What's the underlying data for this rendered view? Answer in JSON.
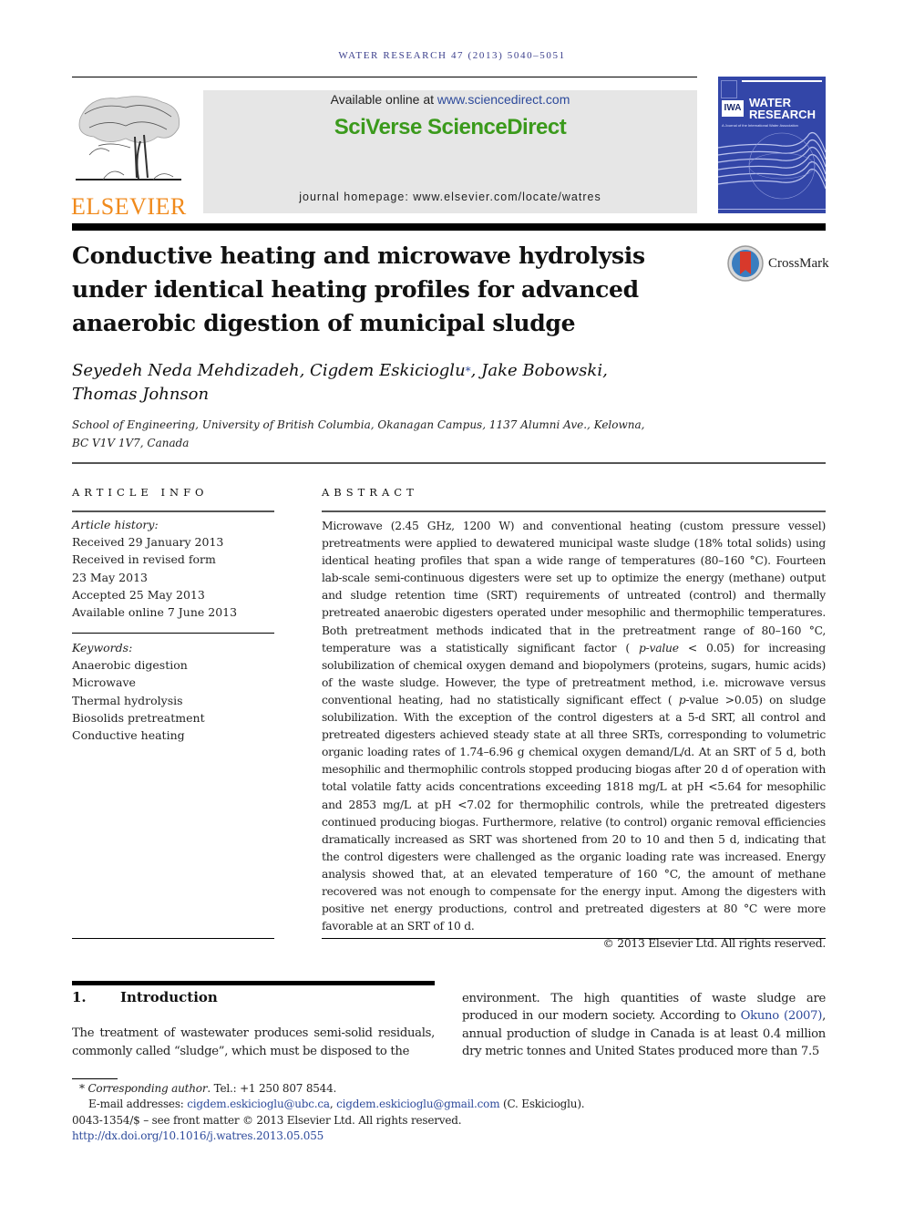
{
  "journal": {
    "running_head": "WATER RESEARCH 47 (2013) 5040–5051",
    "publisher_name": "ELSEVIER",
    "available_online_prefix": "Available online at ",
    "available_online_link": "www.sciencedirect.com",
    "platform_name": "SciVerse ScienceDirect",
    "homepage": "journal homepage: www.elsevier.com/locate/watres",
    "cover": {
      "logo_text": "IWA",
      "title_line1": "WATER",
      "title_line2": "RESEARCH",
      "subtitle": "A Journal of the International Water Association",
      "color": "#3346a8"
    },
    "crossmark_label": "CrossMark"
  },
  "article": {
    "title": "Conductive heating and microwave hydrolysis under identical heating profiles for advanced anaerobic digestion of municipal sludge",
    "authors_part1": "Seyedeh Neda Mehdizadeh, Cigdem Eskicioglu",
    "corresponding_marker": "*",
    "authors_part2": ", Jake Bobowski,",
    "authors_part3": "Thomas Johnson",
    "affiliation_line1": "School of Engineering, University of British Columbia, Okanagan Campus, 1137 Alumni Ave., Kelowna,",
    "affiliation_line2": "BC V1V 1V7, Canada"
  },
  "article_info": {
    "heading": "ARTICLE INFO",
    "history_label": "Article history:",
    "history": [
      "Received 29 January 2013",
      "Received in revised form",
      "23 May 2013",
      "Accepted 25 May 2013",
      "Available online 7 June 2013"
    ],
    "keywords_label": "Keywords:",
    "keywords": [
      "Anaerobic digestion",
      "Microwave",
      "Thermal hydrolysis",
      "Biosolids pretreatment",
      "Conductive heating"
    ]
  },
  "abstract": {
    "heading": "ABSTRACT",
    "text_part1": "Microwave (2.45 GHz, 1200 W) and conventional heating (custom pressure vessel) pretreatments were applied to dewatered municipal waste sludge (18% total solids) using identical heating profiles that span a wide range of temperatures (80–160 °C). Fourteen lab-scale semi-continuous digesters were set up to optimize the energy (methane) output and sludge retention time (SRT) requirements of untreated (control) and thermally pretreated anaerobic digesters operated under mesophilic and thermophilic temperatures. Both pretreatment methods indicated that in the pretreatment range of 80–160 °C, temperature was a statistically significant factor ( ",
    "pvalue1": "p-value",
    "text_part2": " < 0.05) for increasing solubilization of chemical oxygen demand and biopolymers (proteins, sugars, humic acids) of the waste sludge. However, the type of pretreatment method, i.e. microwave versus conventional heating, had no statistically significant effect ( ",
    "pvalue2_p": "p",
    "text_part3": "-value >0.05) on sludge solubilization. With the exception of the control digesters at a 5-d SRT, all control and pretreated digesters achieved steady state at all three SRTs, corresponding to volumetric organic loading rates of 1.74–6.96 g chemical oxygen demand/L/d. At an SRT of 5 d, both mesophilic and thermophilic controls stopped producing biogas after 20 d of operation with total volatile fatty acids concentrations exceeding 1818 mg/L at pH <5.64 for mesophilic and 2853 mg/L at pH <7.02 for thermophilic controls, while the pretreated digesters continued producing biogas. Furthermore, relative (to control) organic removal efficiencies dramatically increased as SRT was shortened from 20 to 10 and then 5 d, indicating that the control digesters were challenged as the organic loading rate was increased. Energy analysis showed that, at an elevated temperature of 160 °C, the amount of methane recovered was not enough to compensate for the energy input. Among the digesters with positive net energy productions, control and pretreated digesters at 80 °C were more favorable at an SRT of 10 d.",
    "copyright": "© 2013 Elsevier Ltd. All rights reserved."
  },
  "introduction": {
    "number": "1.",
    "heading": "Introduction",
    "left_text": "The treatment of wastewater produces semi-solid residuals, commonly called “sludge”, which must be disposed to the",
    "right_text_part1": "environment. The high quantities of waste sludge are produced in our modern society. According to ",
    "citation": "Okuno (2007)",
    "right_text_part2": ", annual production of sludge in Canada is at least 0.4 million dry metric tonnes and United States produced more than 7.5"
  },
  "footnotes": {
    "star": "*",
    "corresponding_label": "Corresponding author",
    "tel": ". Tel.: +1 250 807 8544.",
    "email_label": "E-mail addresses: ",
    "email1": "cigdem.eskicioglu@ubc.ca",
    "email_sep": ", ",
    "email2": "cigdem.eskicioglu@gmail.com",
    "email_suffix": " (C. Eskicioglu).",
    "front_matter": "0043-1354/$ – see front matter © 2013 Elsevier Ltd. All rights reserved.",
    "doi": "http://dx.doi.org/10.1016/j.watres.2013.05.055"
  },
  "colors": {
    "link": "#2d4a9b",
    "elsevier_orange": "#f08a1c",
    "sciencedirect_green": "#3b9a1c"
  }
}
